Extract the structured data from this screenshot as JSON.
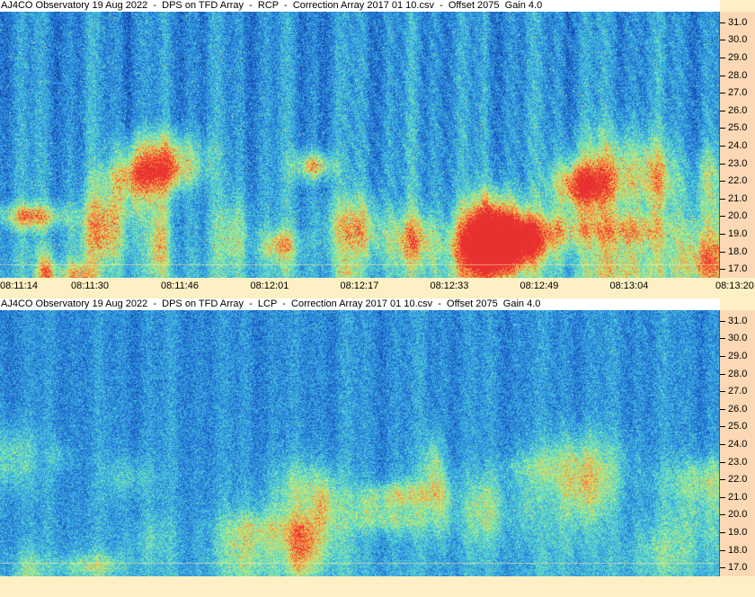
{
  "chart_data": [
    {
      "type": "heatmap",
      "title": "AJ4CO Observatory 19 Aug 2022  -  DPS on TFD Array  -  RCP  -  Correction Array 2017 01 10.csv  -  Offset 2075  Gain 4.0",
      "x_ticks": [
        "08:11:14",
        "08:11:30",
        "08:11:46",
        "08:12:01",
        "08:12:17",
        "08:12:33",
        "08:12:49",
        "08:13:04",
        "08:13:20"
      ],
      "y_ticks": [
        "31.0",
        "30.0",
        "29.0",
        "28.0",
        "27.0",
        "26.0",
        "25.0",
        "24.0",
        "23.0",
        "22.0",
        "21.0",
        "20.0",
        "19.0",
        "18.0",
        "17.0"
      ],
      "ylim": [
        16.5,
        31.6
      ],
      "colormap": [
        "#061650",
        "#0c3494",
        "#1f6ad0",
        "#38a8e6",
        "#5ee0c8",
        "#c8f070",
        "#ff9a40",
        "#e83030"
      ]
    },
    {
      "type": "heatmap",
      "title": "AJ4CO Observatory 19 Aug 2022  -  DPS on TFD Array  -  LCP  -  Correction Array 2017 01 10.csv  -  Offset 2075  Gain 4.0",
      "y_ticks": [
        "31.0",
        "30.0",
        "29.0",
        "28.0",
        "27.0",
        "26.0",
        "25.0",
        "24.0",
        "23.0",
        "22.0",
        "21.0",
        "20.0",
        "19.0",
        "18.0",
        "17.0"
      ],
      "ylim": [
        16.5,
        31.6
      ],
      "colormap": [
        "#061650",
        "#0c3494",
        "#1f6ad0",
        "#38a8e6",
        "#5ee0c8",
        "#c8f070",
        "#ff9a40",
        "#e83030"
      ]
    }
  ]
}
